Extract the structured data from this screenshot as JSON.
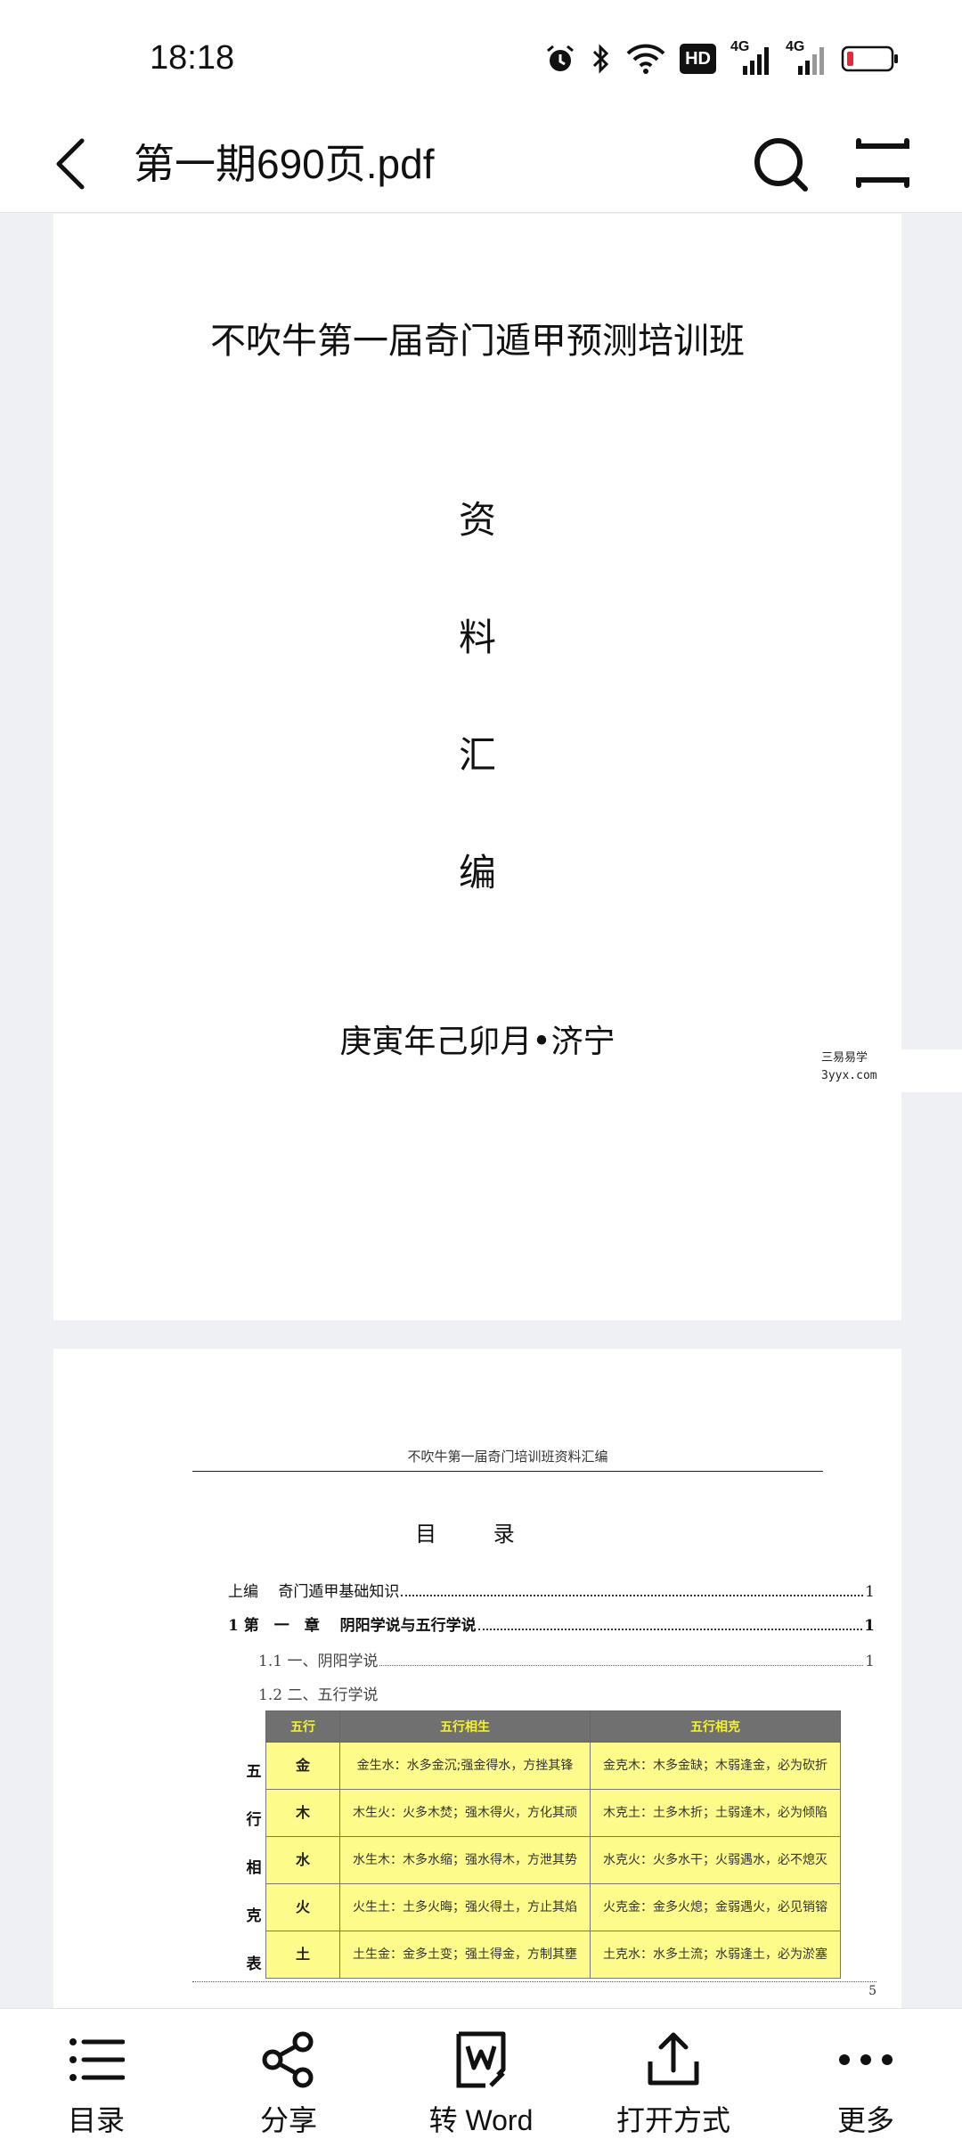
{
  "status_bar": {
    "time": "18:18",
    "network_a": "4G",
    "network_b": "4G",
    "hd_badge": "HD"
  },
  "app_bar": {
    "title": "第一期690页.pdf"
  },
  "page1": {
    "title": "不吹牛第一届奇门遁甲预测培训班",
    "chars": [
      "资",
      "料",
      "汇",
      "编"
    ],
    "footer": "庚寅年己卯月•济宁"
  },
  "watermark": {
    "line1": "三易易学",
    "line2": "3yyx.com"
  },
  "page2": {
    "header": "不吹牛第一届奇门培训班资料汇编",
    "toc_title": "目 录",
    "toc": [
      {
        "label": "上编　 奇门遁甲基础知识",
        "page": "1"
      },
      {
        "label": "1 第　一　章　 阴阳学说与五行学说",
        "page": "1"
      },
      {
        "label": "1.1 一、阴阳学说",
        "page": "1"
      },
      {
        "label": "1.2 二、五行学说",
        "page": ""
      }
    ],
    "side_label": [
      "五",
      "行",
      "相",
      "克",
      "表"
    ],
    "table": {
      "headers": [
        "五行",
        "五行相生",
        "五行相克"
      ],
      "rows": [
        {
          "el": "金",
          "sheng": "金生水：水多金沉;强金得水，方挫其锋",
          "ke": "金克木：木多金缺；木弱逢金，必为砍折"
        },
        {
          "el": "木",
          "sheng": "木生火：火多木焚；强木得火，方化其顽",
          "ke": "木克土：土多木折；土弱逢木，必为倾陷"
        },
        {
          "el": "水",
          "sheng": "水生木：木多水缩；强水得木，方泄其势",
          "ke": "水克火：火多水干；火弱遇水，必不熄灭"
        },
        {
          "el": "火",
          "sheng": "火生土：土多火晦；强火得土，方止其焰",
          "ke": "火克金：金多火熄；金弱遇火，必见销镕"
        },
        {
          "el": "土",
          "sheng": "土生金：金多土变；强土得金，方制其壅",
          "ke": "土克水：水多土流；水弱逢土，必为淤塞"
        }
      ]
    },
    "page_number": "5"
  },
  "bottom_bar": {
    "items": [
      {
        "label": "目录",
        "icon": "list-icon"
      },
      {
        "label": "分享",
        "icon": "share-icon"
      },
      {
        "label": "转 Word",
        "icon": "word-convert-icon"
      },
      {
        "label": "打开方式",
        "icon": "open-with-icon"
      },
      {
        "label": "更多",
        "icon": "more-icon"
      }
    ]
  }
}
